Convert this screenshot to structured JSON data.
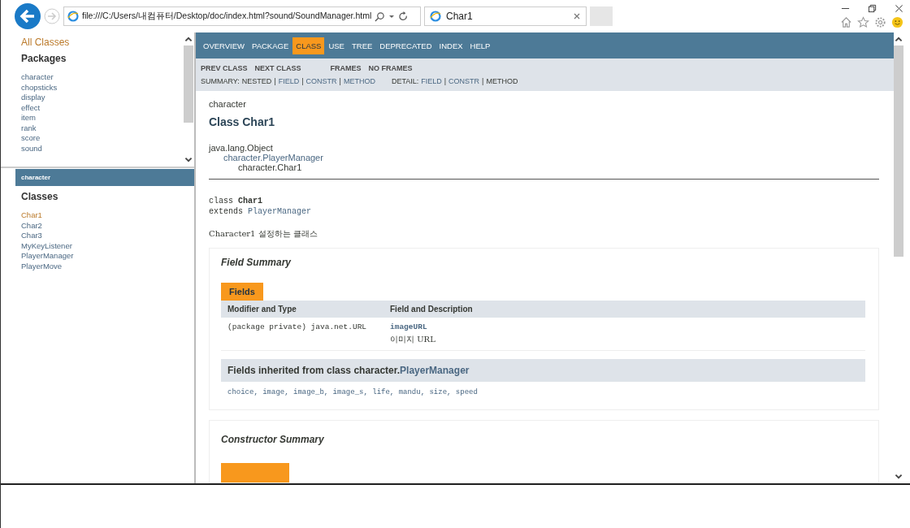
{
  "browser": {
    "address": "file:///C:/Users/내컴퓨터/Desktop/doc/index.html?sound/SoundManager.html",
    "tab_title": "Char1"
  },
  "left_frame": {
    "all_classes": "All Classes",
    "packages_heading": "Packages",
    "packages": [
      "character",
      "chopsticks",
      "display",
      "effect",
      "item",
      "rank",
      "score",
      "sound"
    ],
    "package_header": "character",
    "classes_heading": "Classes",
    "classes": [
      {
        "label": "Char1",
        "selected": true
      },
      {
        "label": "Char2",
        "selected": false
      },
      {
        "label": "Char3",
        "selected": false
      },
      {
        "label": "MyKeyListener",
        "selected": false
      },
      {
        "label": "PlayerManager",
        "selected": false
      },
      {
        "label": "PlayerMove",
        "selected": false
      }
    ]
  },
  "nav": [
    {
      "label": "OVERVIEW",
      "selected": false
    },
    {
      "label": "PACKAGE",
      "selected": false
    },
    {
      "label": "CLASS",
      "selected": true
    },
    {
      "label": "USE",
      "selected": false
    },
    {
      "label": "TREE",
      "selected": false
    },
    {
      "label": "DEPRECATED",
      "selected": false
    },
    {
      "label": "INDEX",
      "selected": false
    },
    {
      "label": "HELP",
      "selected": false
    }
  ],
  "subnav": {
    "links": [
      "PREV CLASS",
      "NEXT CLASS"
    ],
    "frames": [
      "FRAMES",
      "NO FRAMES"
    ],
    "summary_label": "SUMMARY:",
    "separator": "|",
    "summary": [
      {
        "label": "NESTED",
        "link": false
      },
      {
        "label": "FIELD",
        "link": true
      },
      {
        "label": "CONSTR",
        "link": true
      },
      {
        "label": "METHOD",
        "link": true
      }
    ],
    "detail_label": "DETAIL:",
    "detail": [
      {
        "label": "FIELD",
        "link": true
      },
      {
        "label": "CONSTR",
        "link": true
      },
      {
        "label": "METHOD",
        "link": false
      }
    ]
  },
  "content": {
    "package": "character",
    "title": "Class Char1",
    "inheritance": [
      {
        "label": "java.lang.Object",
        "link": false
      },
      {
        "label": "character.PlayerManager",
        "link": true
      },
      {
        "label": "character.Char1",
        "link": false
      }
    ],
    "signature": {
      "keyword": "class",
      "name": "Char1",
      "extends": "extends",
      "superclass": "PlayerManager"
    },
    "description": "Character1 설정하는 클래스",
    "field_summary": {
      "heading": "Field Summary",
      "tab": "Fields",
      "columns": [
        "Modifier and Type",
        "Field and Description"
      ],
      "rows": [
        {
          "type": "(package private) java.net.URL",
          "name": "imageURL",
          "description": "이미지 URL"
        }
      ],
      "inherited_prefix": "Fields inherited from class character.",
      "inherited_class": "PlayerManager",
      "inherited_fields": "choice, image, image_b, image_s, life, mandu, size, speed"
    },
    "constructor_summary": {
      "heading": "Constructor Summary"
    }
  }
}
